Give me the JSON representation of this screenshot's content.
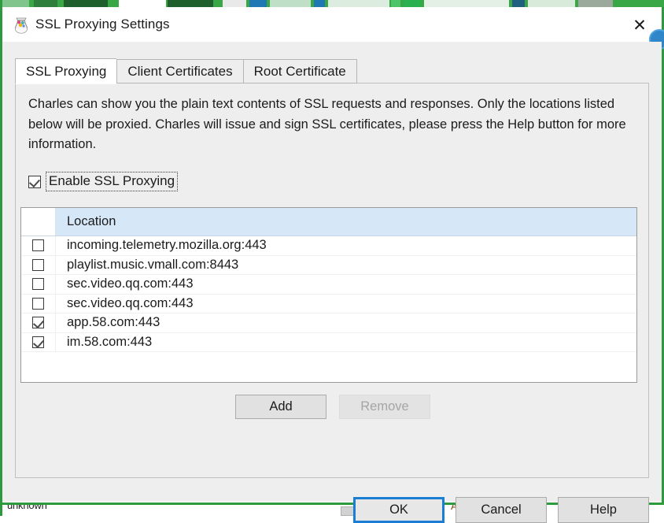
{
  "window": {
    "title": "SSL Proxying Settings",
    "app_icon": "charles-vase-icon",
    "close_icon": "close-icon"
  },
  "tabs": [
    {
      "label": "SSL Proxying",
      "active": true
    },
    {
      "label": "Client Certificates",
      "active": false
    },
    {
      "label": "Root Certificate",
      "active": false
    }
  ],
  "panel": {
    "description": "Charles can show you the plain text contents of SSL requests and responses. Only the locations listed below will be proxied. Charles will issue and sign SSL certificates, please press the Help button for more information.",
    "enable_checkbox": {
      "label": "Enable SSL Proxying",
      "checked": true,
      "focused": true
    },
    "table": {
      "columns": [
        "",
        "Location"
      ],
      "rows": [
        {
          "checked": false,
          "location": "incoming.telemetry.mozilla.org:443"
        },
        {
          "checked": false,
          "location": "playlist.music.vmall.com:8443"
        },
        {
          "checked": false,
          "location": "sec.video.qq.com:443"
        },
        {
          "checked": false,
          "location": "sec.video.qq.com:443"
        },
        {
          "checked": true,
          "location": "app.58.com:443"
        },
        {
          "checked": true,
          "location": "im.58.com:443"
        }
      ]
    },
    "list_buttons": [
      {
        "label": "Add",
        "enabled": true
      },
      {
        "label": "Remove",
        "enabled": false
      }
    ]
  },
  "footer": {
    "buttons": [
      {
        "label": "OK",
        "default": true
      },
      {
        "label": "Cancel",
        "default": false
      },
      {
        "label": "Help",
        "default": false
      }
    ]
  },
  "background": {
    "bottom_left_text": "unknown",
    "bottom_right_text": "Add",
    "accent_color": "#3aa746"
  },
  "colors": {
    "accent": "#1a7fd4",
    "table_header": "#d6e7f7",
    "dialog_bg": "#efeeee",
    "background_green": "#3aa746"
  }
}
